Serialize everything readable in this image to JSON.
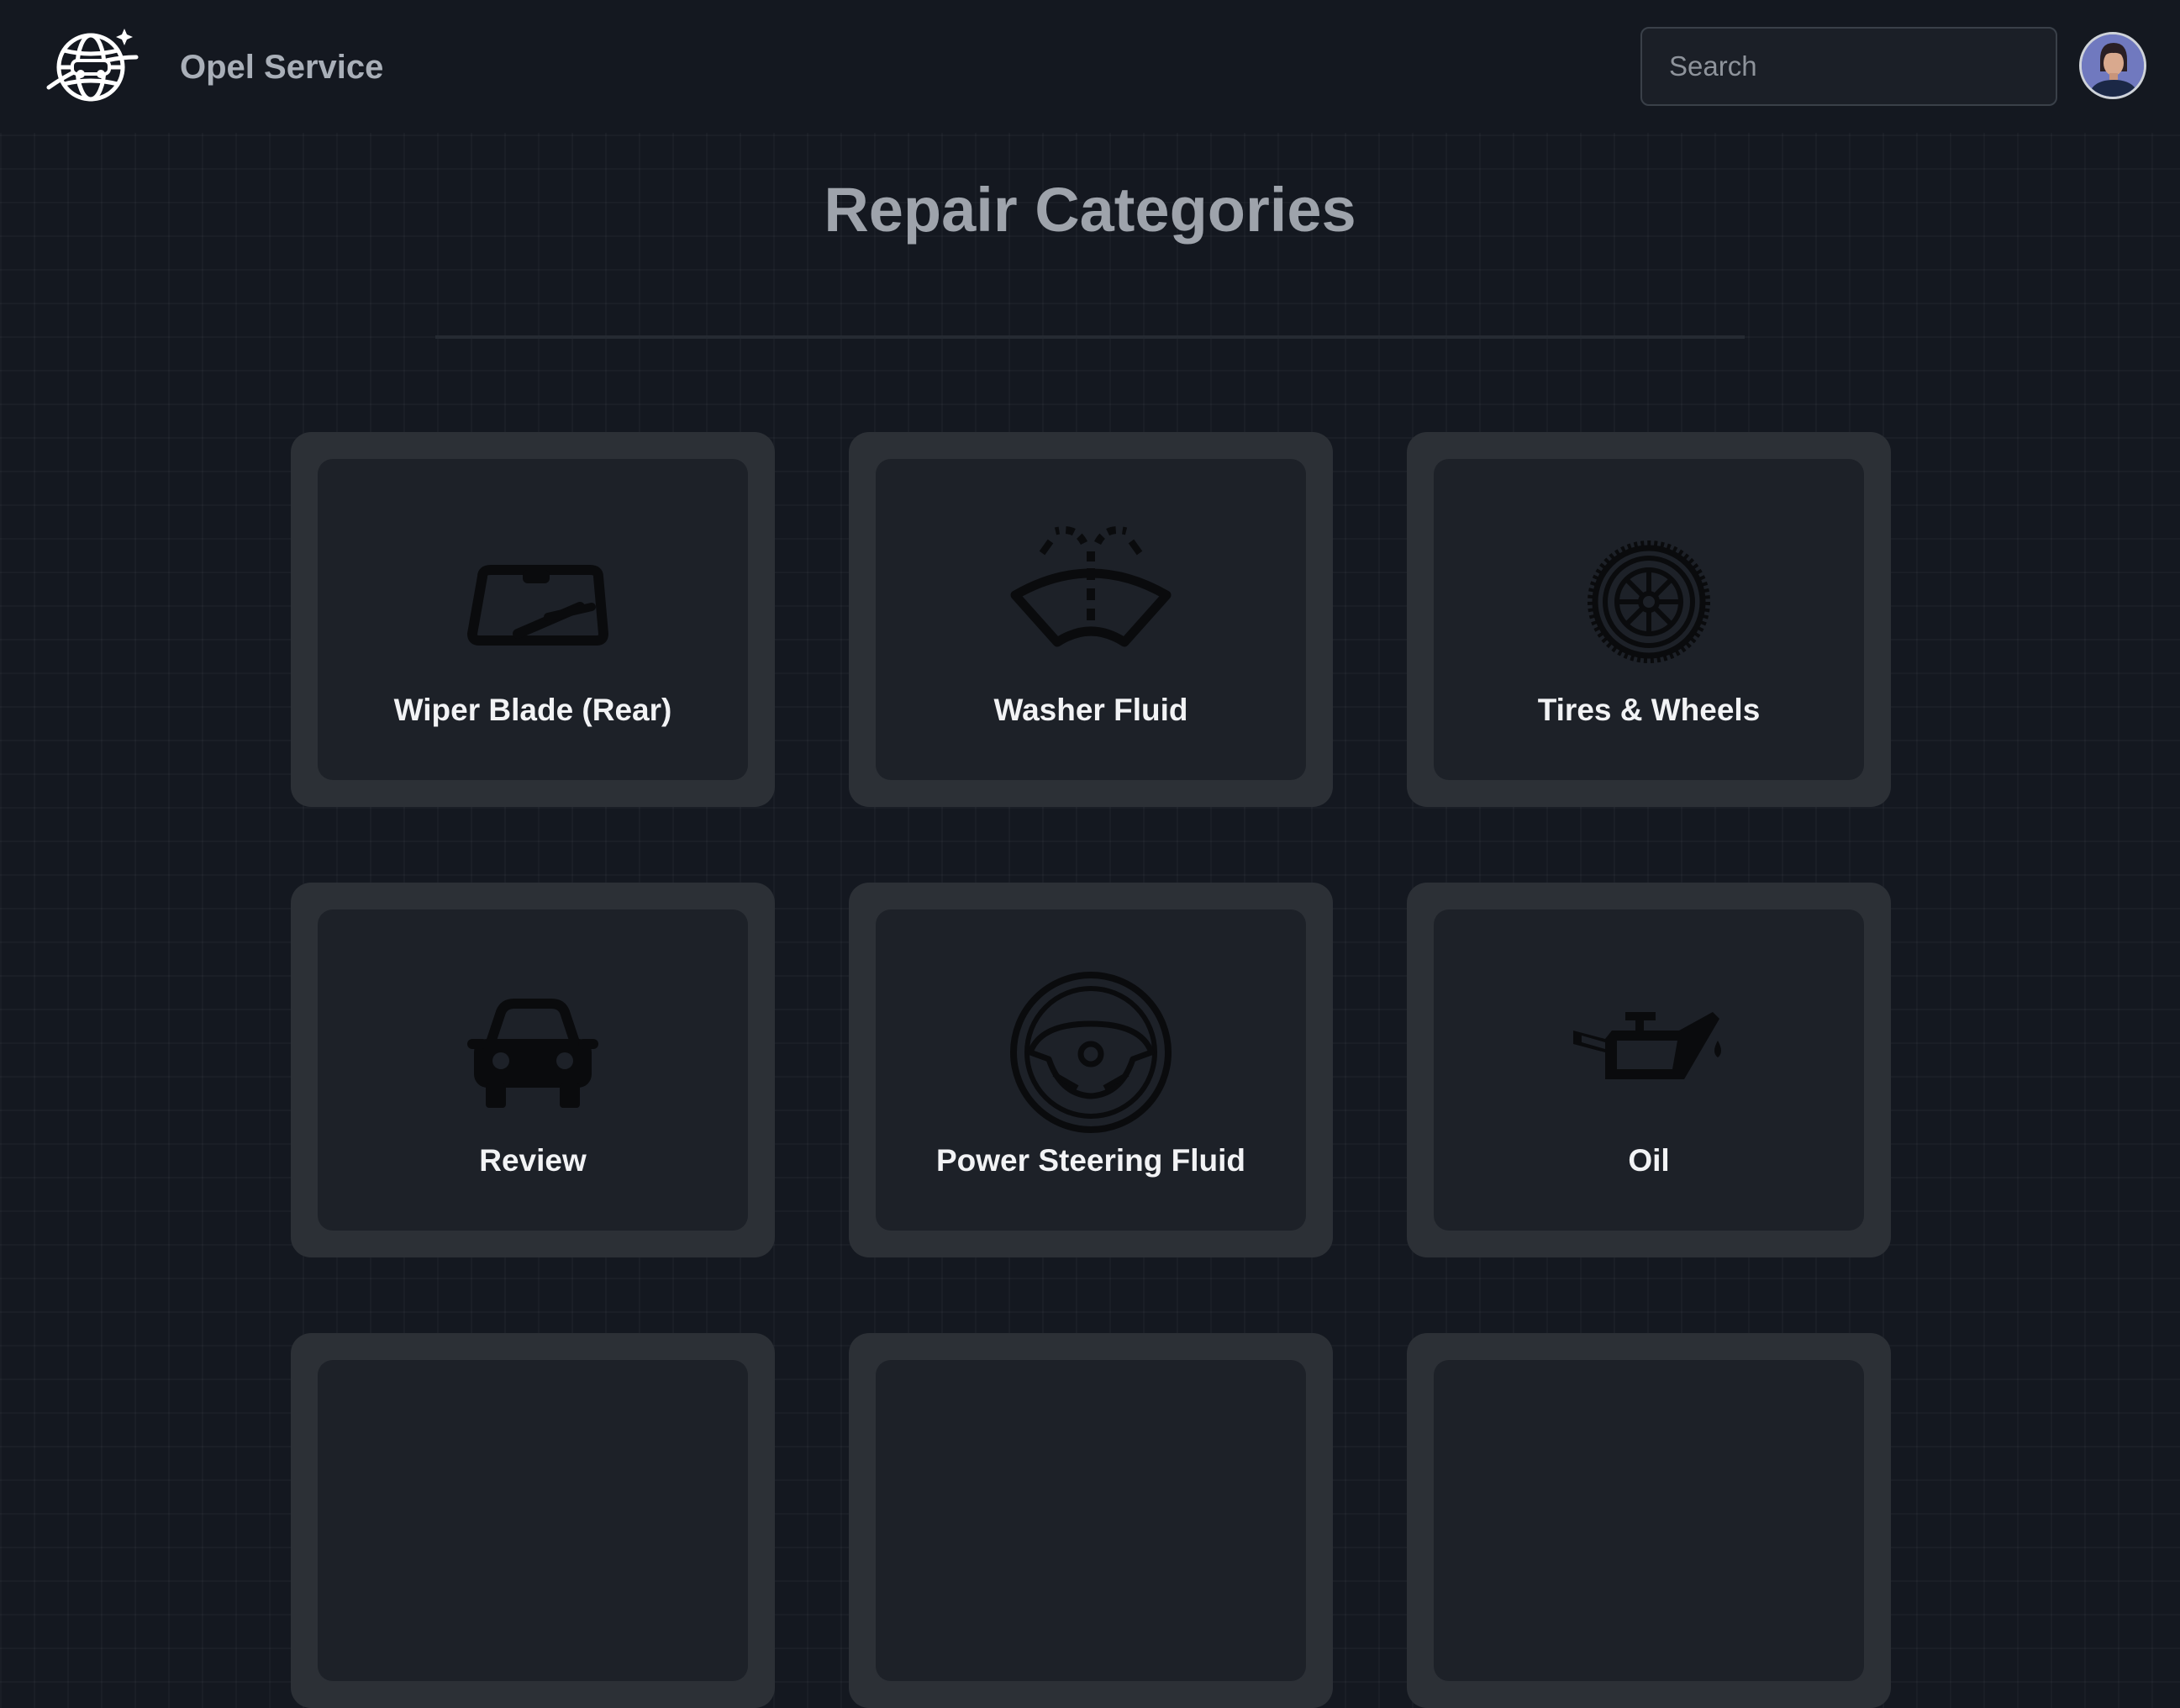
{
  "header": {
    "logo_icon": "car-globe-logo-icon",
    "brand": "Opel Service",
    "search_placeholder": "Search",
    "avatar_icon": "user-avatar"
  },
  "main": {
    "title": "Repair Categories",
    "categories": [
      {
        "label": "Wiper Blade (Rear)",
        "icon": "windshield-wiper-icon"
      },
      {
        "label": "Washer Fluid",
        "icon": "washer-fluid-icon"
      },
      {
        "label": "Tires & Wheels",
        "icon": "tire-wheel-icon"
      },
      {
        "label": "Review",
        "icon": "car-icon"
      },
      {
        "label": "Power Steering Fluid",
        "icon": "steering-wheel-icon"
      },
      {
        "label": "Oil",
        "icon": "oil-can-icon"
      }
    ]
  },
  "colors": {
    "background": "#141820",
    "card_outer": "#2c3036",
    "card_inner": "#1d2128",
    "title": "#9ea3ab",
    "card_text": "#f2f3f5"
  }
}
